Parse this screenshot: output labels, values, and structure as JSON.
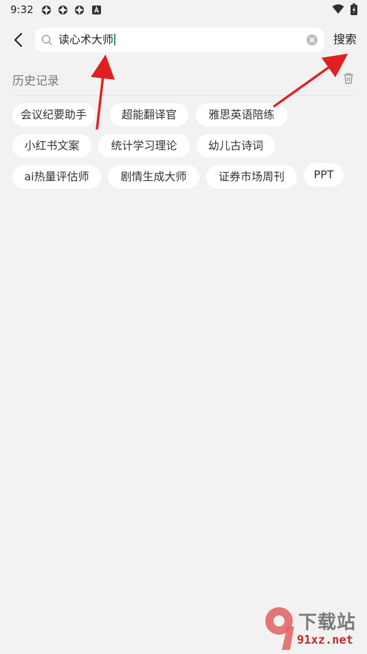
{
  "status_bar": {
    "time": "9:32",
    "icons": [
      "notification-app-icon",
      "notification-app-icon",
      "notification-app-icon",
      "a-keyboard-icon"
    ],
    "right_icons": [
      "wifi-icon",
      "battery-icon"
    ]
  },
  "search": {
    "query": "读心术大师",
    "button_label": "搜索",
    "accent_color": "#1aa37a"
  },
  "history": {
    "title": "历史记录",
    "tags": [
      "会议纪要助手",
      "超能翻译官",
      "雅思英语陪练",
      "小红书文案",
      "统计学习理论",
      "幼儿古诗词",
      "ai热量评估师",
      "剧情生成大师",
      "证券市场周刊",
      "PPT"
    ]
  },
  "annotation": {
    "arrow_color": "#e02020"
  },
  "watermark": {
    "brand": "下载站",
    "url": "91xz.net"
  }
}
